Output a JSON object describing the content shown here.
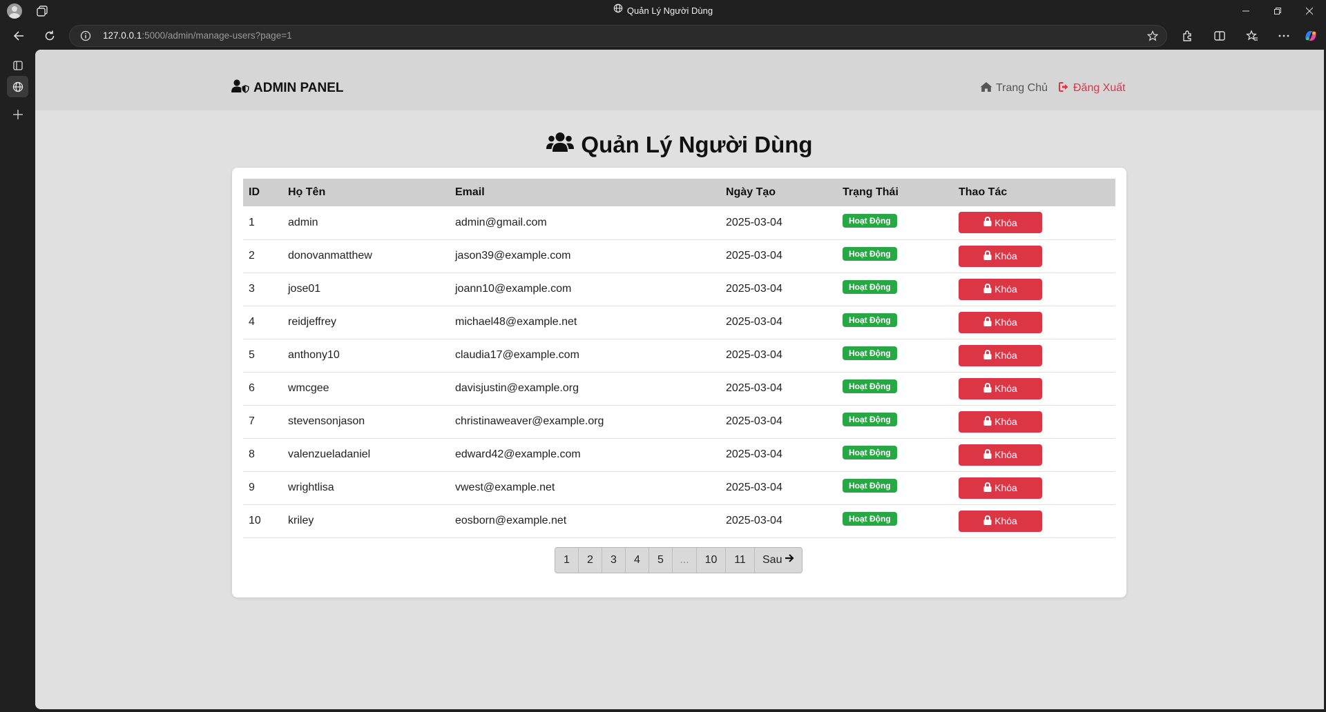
{
  "browser": {
    "tab_title": "Quản Lý Người Dùng",
    "url_host": "127.0.0.1",
    "url_path": ":5000/admin/manage-users?page=1"
  },
  "navbar": {
    "brand": "ADMIN PANEL",
    "home_label": "Trang Chủ",
    "logout_label": "Đăng Xuất"
  },
  "page": {
    "title": "Quản Lý Người Dùng"
  },
  "table": {
    "headers": {
      "id": "ID",
      "name": "Họ Tên",
      "email": "Email",
      "created": "Ngày Tạo",
      "status": "Trạng Thái",
      "actions": "Thao Tác"
    },
    "rows": [
      {
        "id": "1",
        "name": "admin",
        "email": "admin@gmail.com",
        "created": "2025-03-04",
        "status": "Hoạt Động",
        "action": "Khóa"
      },
      {
        "id": "2",
        "name": "donovanmatthew",
        "email": "jason39@example.com",
        "created": "2025-03-04",
        "status": "Hoạt Động",
        "action": "Khóa"
      },
      {
        "id": "3",
        "name": "jose01",
        "email": "joann10@example.com",
        "created": "2025-03-04",
        "status": "Hoạt Động",
        "action": "Khóa"
      },
      {
        "id": "4",
        "name": "reidjeffrey",
        "email": "michael48@example.net",
        "created": "2025-03-04",
        "status": "Hoạt Động",
        "action": "Khóa"
      },
      {
        "id": "5",
        "name": "anthony10",
        "email": "claudia17@example.com",
        "created": "2025-03-04",
        "status": "Hoạt Động",
        "action": "Khóa"
      },
      {
        "id": "6",
        "name": "wmcgee",
        "email": "davisjustin@example.org",
        "created": "2025-03-04",
        "status": "Hoạt Động",
        "action": "Khóa"
      },
      {
        "id": "7",
        "name": "stevensonjason",
        "email": "christinaweaver@example.org",
        "created": "2025-03-04",
        "status": "Hoạt Động",
        "action": "Khóa"
      },
      {
        "id": "8",
        "name": "valenzueladaniel",
        "email": "edward42@example.com",
        "created": "2025-03-04",
        "status": "Hoạt Động",
        "action": "Khóa"
      },
      {
        "id": "9",
        "name": "wrightlisa",
        "email": "vwest@example.net",
        "created": "2025-03-04",
        "status": "Hoạt Động",
        "action": "Khóa"
      },
      {
        "id": "10",
        "name": "kriley",
        "email": "eosborn@example.net",
        "created": "2025-03-04",
        "status": "Hoạt Động",
        "action": "Khóa"
      }
    ]
  },
  "pagination": {
    "pages": [
      "1",
      "2",
      "3",
      "4",
      "5"
    ],
    "ellipsis": "...",
    "last_pages": [
      "10",
      "11"
    ],
    "next_label": "Sau"
  },
  "colors": {
    "status_active": "#28a745",
    "lock_button": "#dc3545",
    "logout_link": "#dc3545"
  }
}
